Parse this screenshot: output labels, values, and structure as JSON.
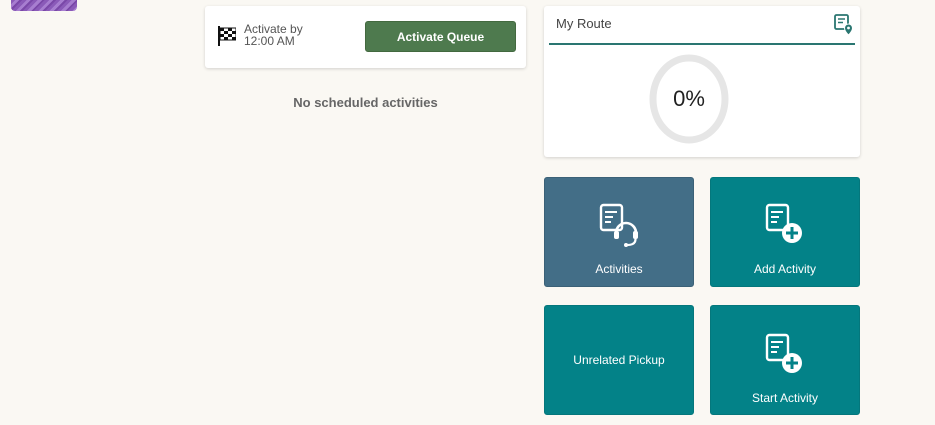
{
  "queue": {
    "activate_by_label": "Activate by",
    "activate_by_time": "12:00 AM",
    "activate_button_label": "Activate Queue",
    "empty_message": "No scheduled activities"
  },
  "route": {
    "title": "My Route",
    "progress_label": "0%",
    "progress_percent": 0
  },
  "tiles": {
    "activities": "Activities",
    "add_activity": "Add Activity",
    "unrelated_pickup": "Unrelated Pickup",
    "start_activity": "Start Activity"
  },
  "icons": {
    "queue": "checkered-flag-icon",
    "route": "route-map-icon",
    "activities": "activities-headset-icon",
    "add_activity": "add-activity-icon",
    "start_activity": "start-activity-icon"
  },
  "colors": {
    "background": "#faf8f3",
    "activate_button": "#4e7a4e",
    "route_accent": "#2a7671",
    "tile_primary": "#038288",
    "tile_activities": "#436e87"
  }
}
